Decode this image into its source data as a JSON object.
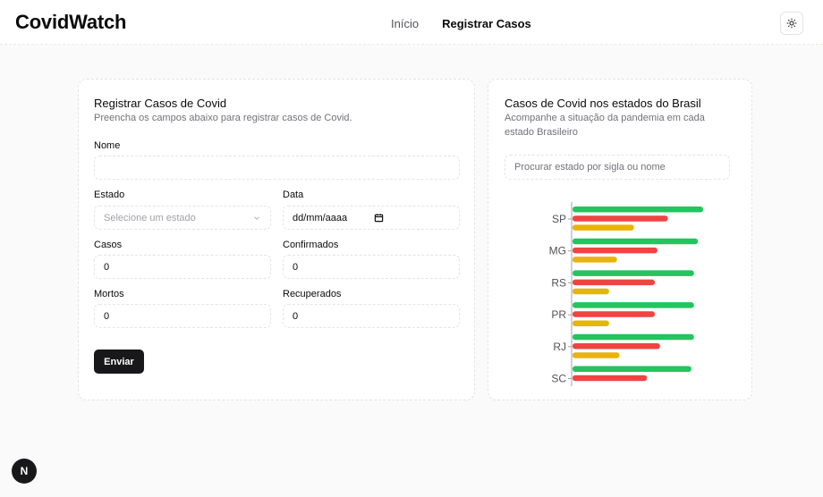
{
  "app": {
    "brand": "CovidWatch"
  },
  "nav": {
    "home": "Início",
    "register": "Registrar Casos"
  },
  "form": {
    "title": "Registrar Casos de Covid",
    "description": "Preencha os campos abaixo para registrar casos de Covid.",
    "name_label": "Nome",
    "name_value": "",
    "state_label": "Estado",
    "state_placeholder": "Selecione um estado",
    "date_label": "Data",
    "date_placeholder": "dd/mm/aaaa",
    "cases_label": "Casos",
    "cases_value": "0",
    "confirmed_label": "Confirmados",
    "confirmed_value": "0",
    "deaths_label": "Mortos",
    "deaths_value": "0",
    "recovered_label": "Recuperados",
    "recovered_value": "0",
    "submit_label": "Enviar"
  },
  "chart_card": {
    "title": "Casos de Covid nos estados do Brasil",
    "description": "Acompanhe a situação da pandemia em cada estado Brasileiro",
    "search_placeholder": "Procurar estado por sigla ou nome"
  },
  "chart_data": {
    "type": "bar",
    "orientation": "horizontal",
    "categories": [
      "SP",
      "MG",
      "RS",
      "PR",
      "RJ",
      "SC"
    ],
    "series": [
      {
        "color": "#22c55e",
        "values": [
          100,
          96,
          93,
          93,
          93,
          91
        ]
      },
      {
        "color": "#ef4444",
        "values": [
          73,
          65,
          63,
          63,
          67,
          57
        ]
      },
      {
        "color": "#eab308",
        "values": [
          47,
          34,
          28,
          28,
          36,
          0
        ]
      }
    ],
    "grid": false,
    "legend": "none"
  },
  "badge": {
    "label": "N"
  },
  "icons": {
    "theme": "sun-icon",
    "select": "chevron-down-icon",
    "date": "calendar-icon"
  }
}
